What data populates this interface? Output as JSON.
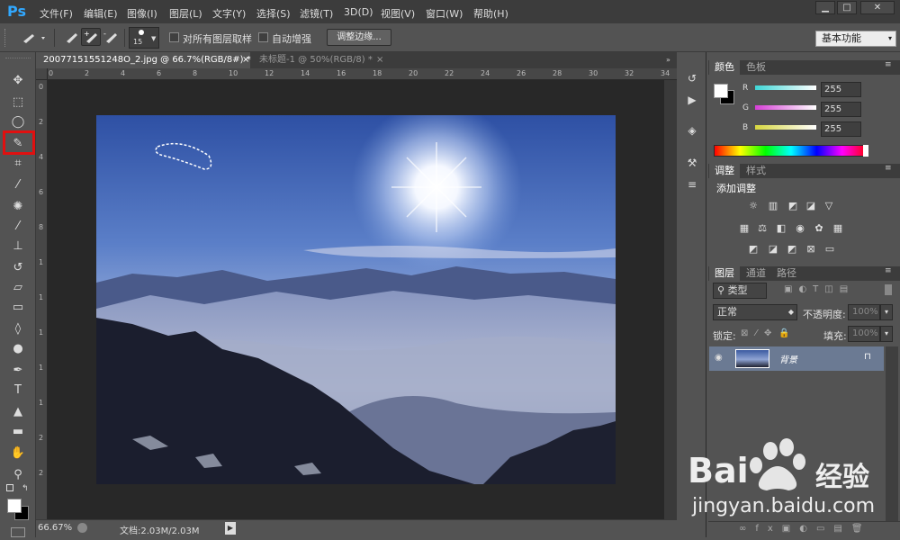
{
  "app": {
    "logo": "Ps"
  },
  "menu": [
    "文件(F)",
    "编辑(E)",
    "图像(I)",
    "图层(L)",
    "文字(Y)",
    "选择(S)",
    "滤镜(T)",
    "3D(D)",
    "视图(V)",
    "窗口(W)",
    "帮助(H)"
  ],
  "window_buttons": [
    "▁",
    "□",
    "✕"
  ],
  "options": {
    "brush_size": "15",
    "sample_all_layers": "对所有图层取样",
    "auto_enhance": "自动增强",
    "refine_edge": "调整边缘...",
    "workspace": "基本功能"
  },
  "tabs": [
    {
      "label": "20077151551248O_2.jpg @ 66.7%(RGB/8#) *",
      "close": "×"
    },
    {
      "label": "未标题-1 @ 50%(RGB/8) *",
      "close": "×"
    }
  ],
  "ruler_top": [
    "0",
    "2",
    "4",
    "6",
    "8",
    "10",
    "12",
    "14",
    "16",
    "18",
    "20",
    "22",
    "24",
    "26",
    "28",
    "30",
    "32",
    "34"
  ],
  "ruler_left": [
    "0",
    "2",
    "4",
    "6",
    "8",
    "1",
    "1",
    "1",
    "1",
    "1",
    "2",
    "2"
  ],
  "status": {
    "zoom": "66.67%",
    "doc": "文档:2.03M/2.03M"
  },
  "color_panel": {
    "tabs": [
      "颜色",
      "色板"
    ],
    "channels": [
      {
        "label": "R",
        "value": "255"
      },
      {
        "label": "G",
        "value": "255"
      },
      {
        "label": "B",
        "value": "255"
      }
    ],
    "accent_colors": {
      "r": "#3fd6d6",
      "g": "#d63fd6",
      "b": "#d6d63f"
    }
  },
  "adjust_panel": {
    "tabs": [
      "调整",
      "样式"
    ],
    "title": "添加调整"
  },
  "layers_panel": {
    "tabs": [
      "图层",
      "通道",
      "路径"
    ],
    "kind": "类型",
    "blend_mode": "正常",
    "opacity_label": "不透明度:",
    "opacity": "100%",
    "lock_label": "锁定:",
    "fill_label": "填充:",
    "fill": "100%",
    "layer_name": "背景"
  },
  "watermark": {
    "brand": "Bai",
    "brand2": "经验",
    "url": "jingyan.baidu.com"
  }
}
